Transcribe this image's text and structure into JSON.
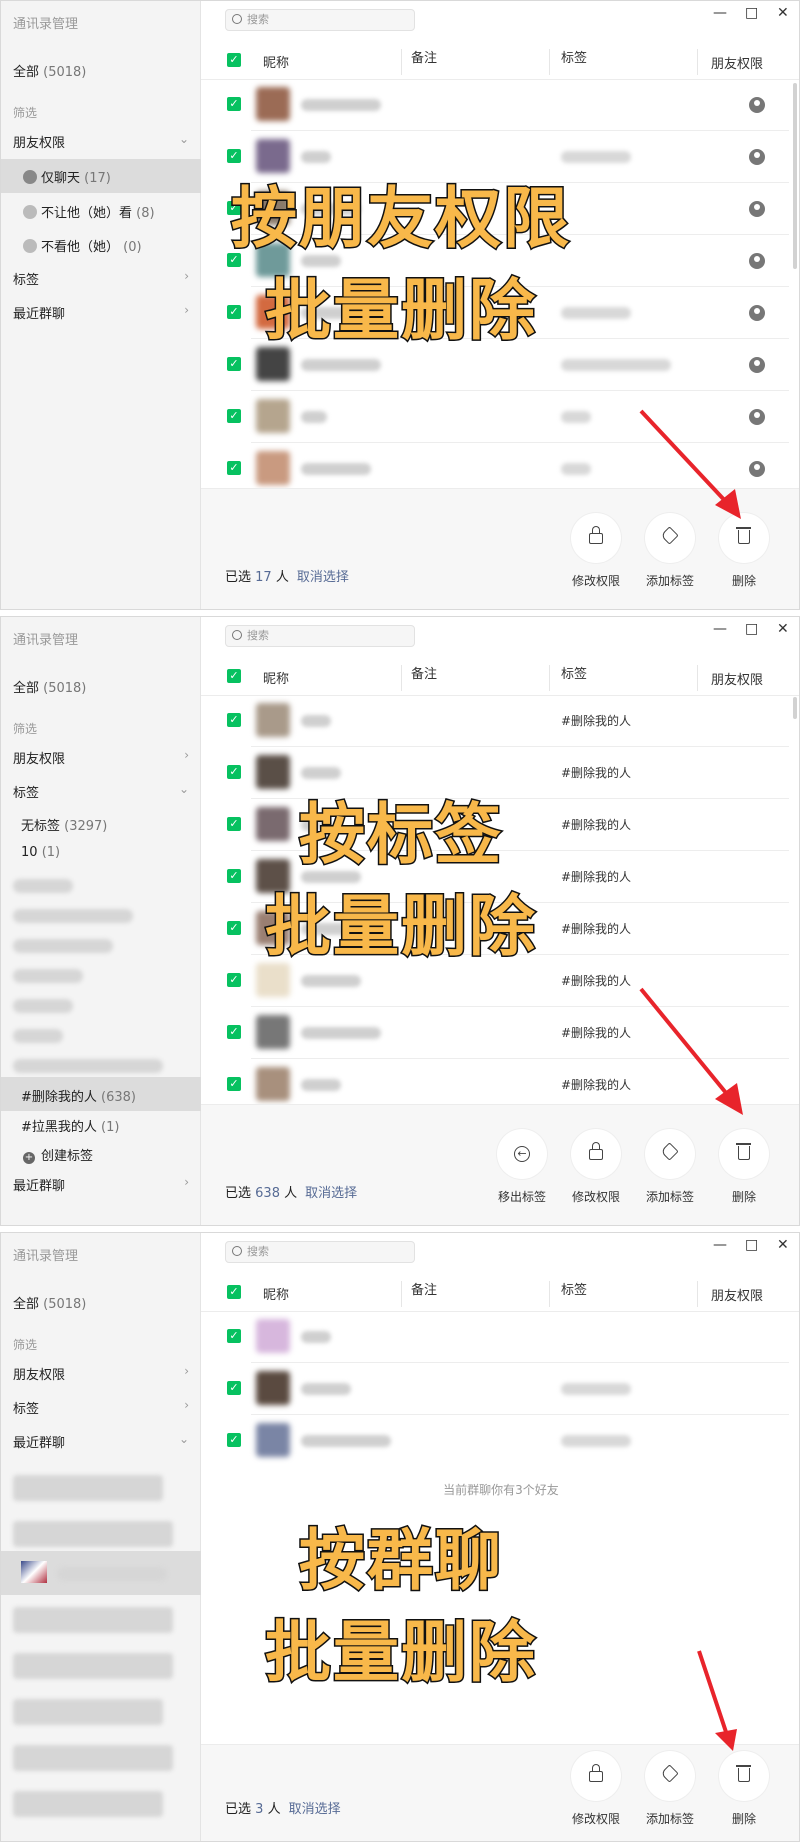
{
  "colors": {
    "accent_green": "#07c160",
    "link_blue": "#576b95",
    "overlay_orange": "#f8b84a",
    "arrow_red": "#e8242b"
  },
  "window": {
    "title": "通讯录管理",
    "search_placeholder": "搜索",
    "min": "—",
    "max": "□",
    "close": "✕"
  },
  "columns": {
    "nickname": "昵称",
    "remark": "备注",
    "tag": "标签",
    "permission": "朋友权限"
  },
  "actions": {
    "remove_tag": "移出标签",
    "change_perm": "修改权限",
    "add_tag": "添加标签",
    "delete": "删除",
    "cancel": "取消选择",
    "selected_prefix": "已选",
    "selected_suffix": "人"
  },
  "panel1": {
    "all_label": "全部",
    "all_count": "(5018)",
    "filter_label": "筛选",
    "perm_label": "朋友权限",
    "perm_chat_only": "仅聊天",
    "perm_chat_only_count": "(17)",
    "perm_hide_mine": "不让他（她）看",
    "perm_hide_mine_count": "(8)",
    "perm_hide_theirs": "不看他（她）",
    "perm_hide_theirs_count": "(0)",
    "tag_label": "标签",
    "recent_group_label": "最近群聊",
    "selected_count": "17",
    "overlay_line1": "按朋友权限",
    "overlay_line2": "批量删除"
  },
  "panel2": {
    "all_label": "全部",
    "all_count": "(5018)",
    "filter_label": "筛选",
    "perm_label": "朋友权限",
    "tag_label": "标签",
    "no_tag": "无标签",
    "no_tag_count": "(3297)",
    "tag_10": "10",
    "tag_10_count": "(1)",
    "tag_deleted": "#删除我的人",
    "tag_deleted_count": "(638)",
    "tag_blocked": "#拉黑我的人",
    "tag_blocked_count": "(1)",
    "create_tag": "创建标签",
    "recent_group_label": "最近群聊",
    "row_tags": [
      "#删除我的人",
      "#删除我的人",
      "#删除我的人",
      "#删除我的人",
      "#删除我的人",
      "#删除我的人",
      "#删除我的人",
      "#删除我的人"
    ],
    "selected_count": "638",
    "overlay_line1": "按标签",
    "overlay_line2": "批量删除"
  },
  "panel3": {
    "all_label": "全部",
    "all_count": "(5018)",
    "filter_label": "筛选",
    "perm_label": "朋友权限",
    "tag_label": "标签",
    "recent_group_label": "最近群聊",
    "group_note": "当前群聊你有3个好友",
    "selected_count": "3",
    "overlay_line1": "按群聊",
    "overlay_line2": "批量删除"
  }
}
